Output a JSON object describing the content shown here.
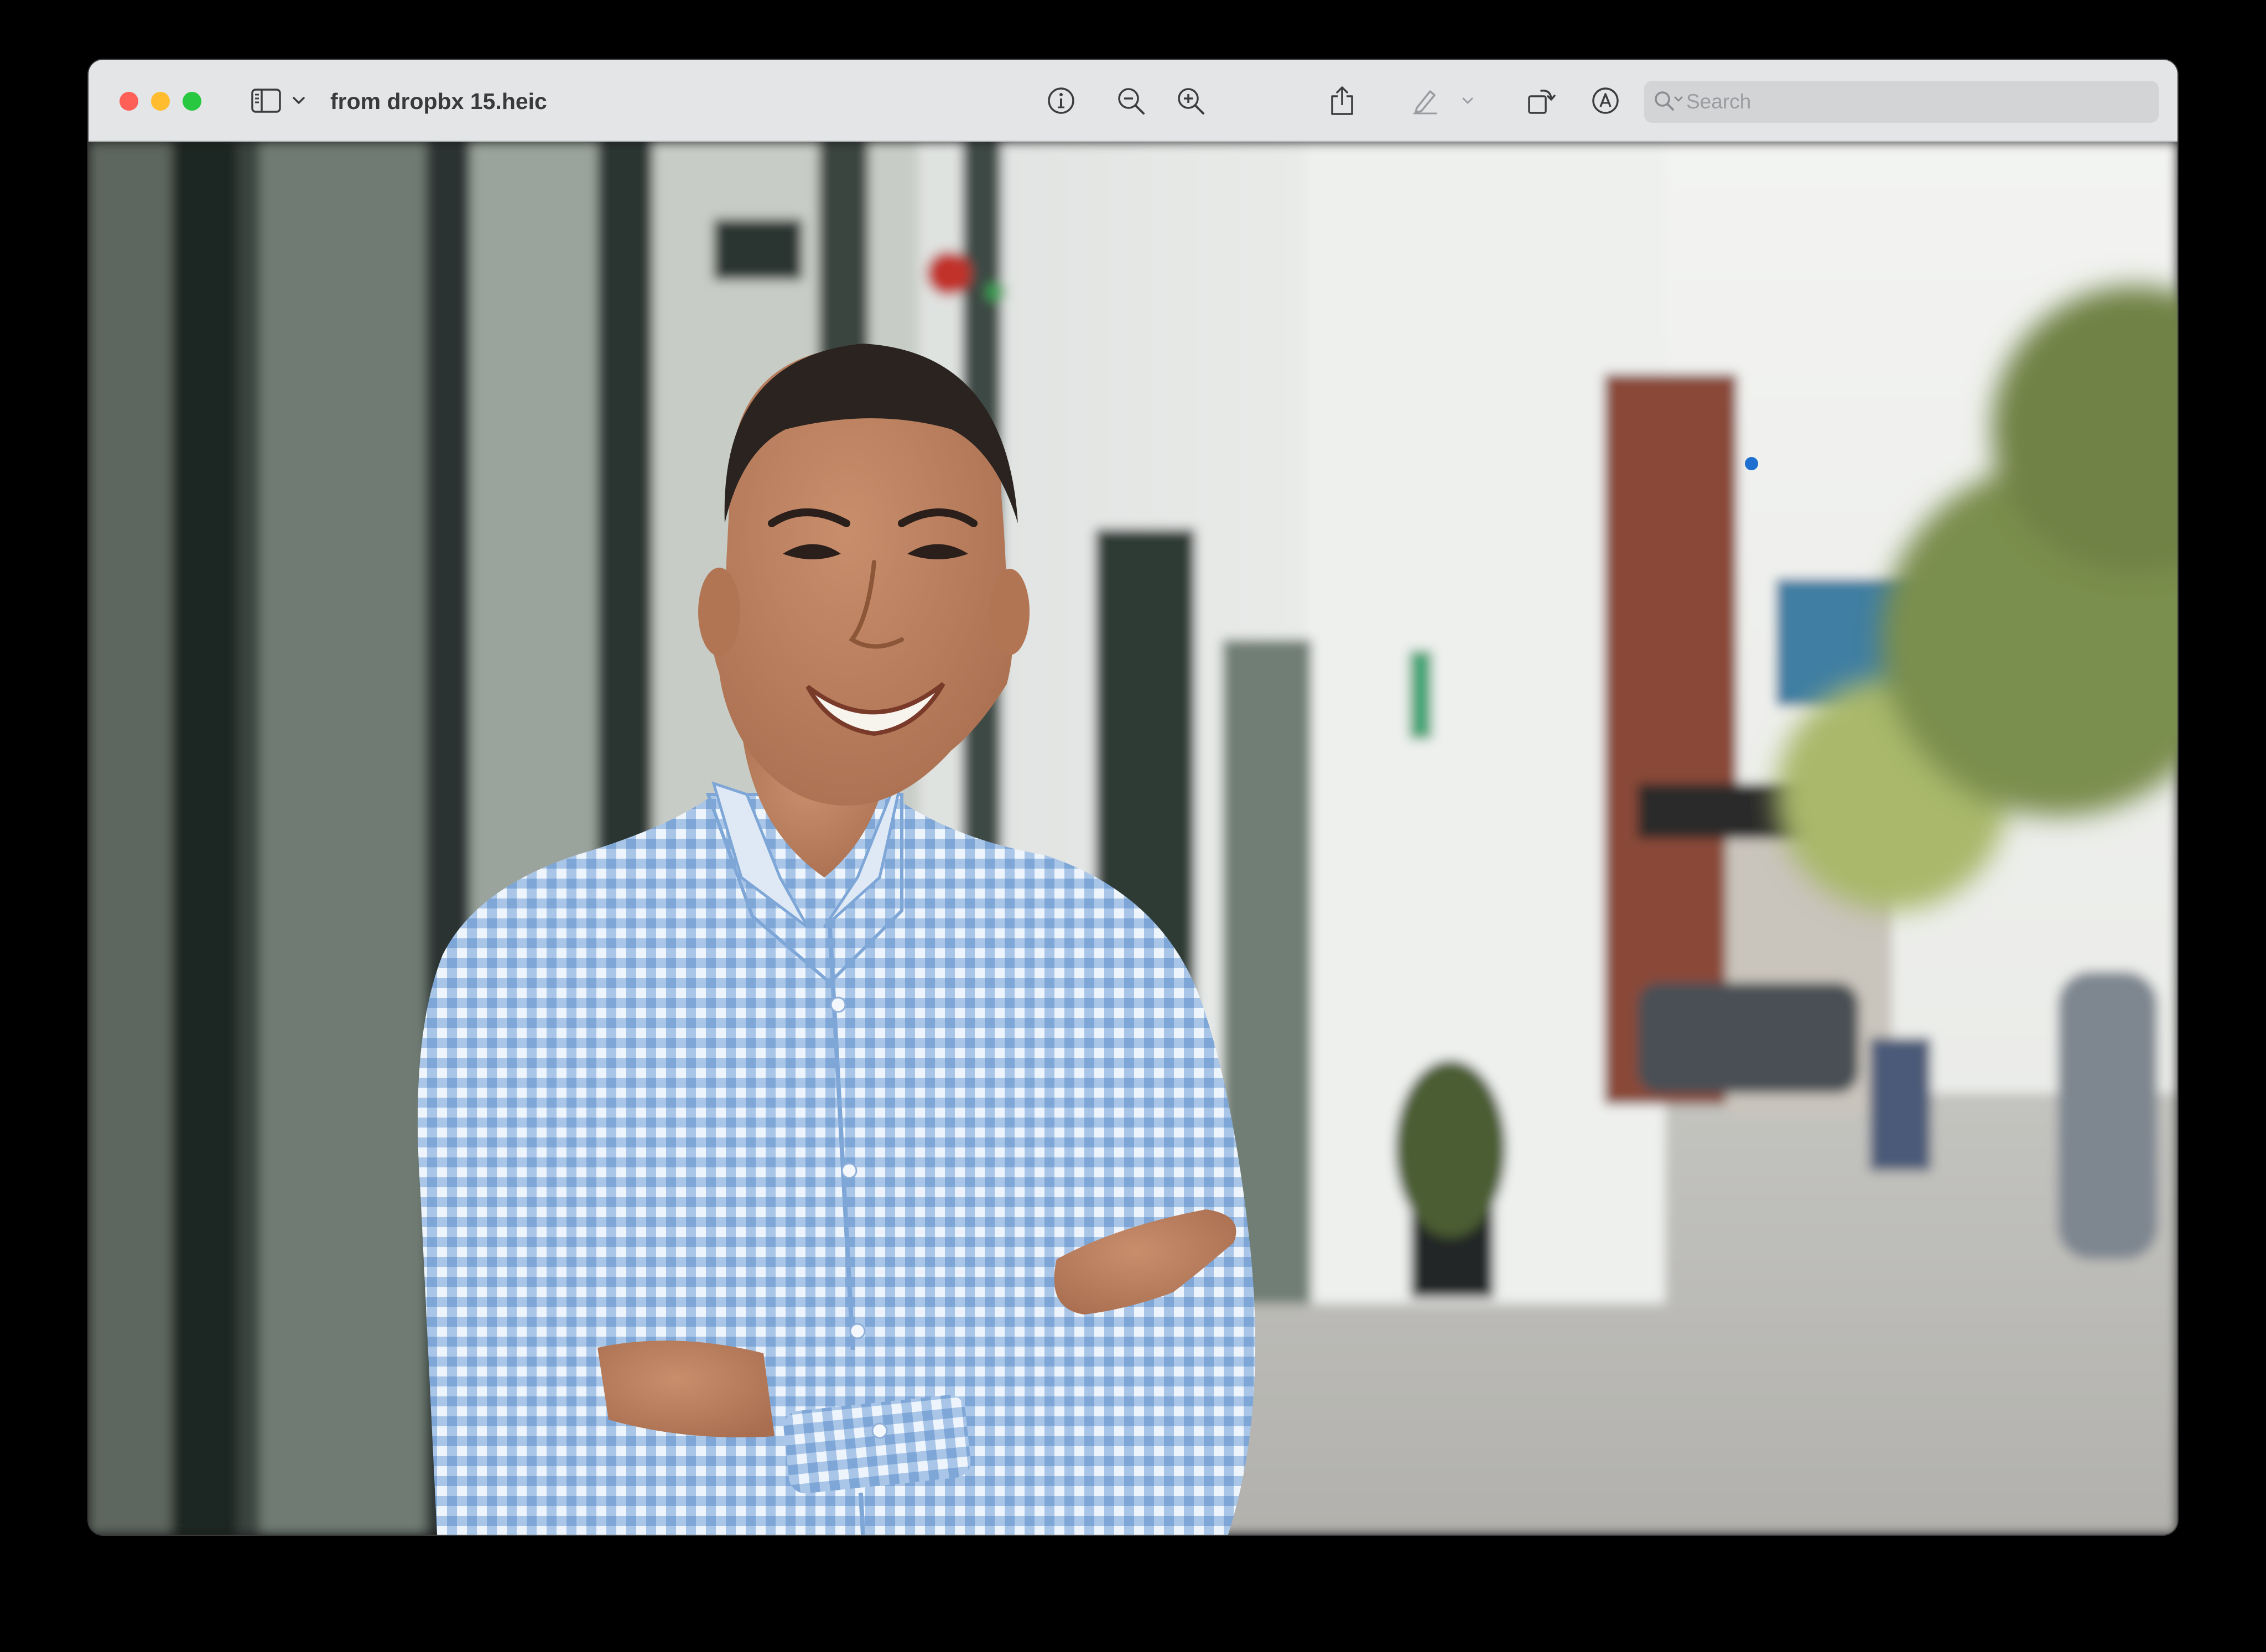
{
  "window": {
    "title": "from dropbx 15.heic"
  },
  "toolbar": {
    "traffic_colors": {
      "close": "#fe5f57",
      "minimize": "#febc2e",
      "zoom": "#28c840"
    },
    "icons": [
      "sidebar-icon",
      "chevron-down-icon",
      "info-icon",
      "zoom-out-icon",
      "zoom-in-icon",
      "share-icon",
      "markup-pen-icon",
      "markup-chevron-icon",
      "rotate-icon",
      "annotate-icon",
      "signature-icon",
      "search-icon"
    ]
  },
  "search": {
    "placeholder": "Search",
    "value": ""
  },
  "photo": {
    "subject": "portrait",
    "accent_color": "#1f6fd1"
  }
}
